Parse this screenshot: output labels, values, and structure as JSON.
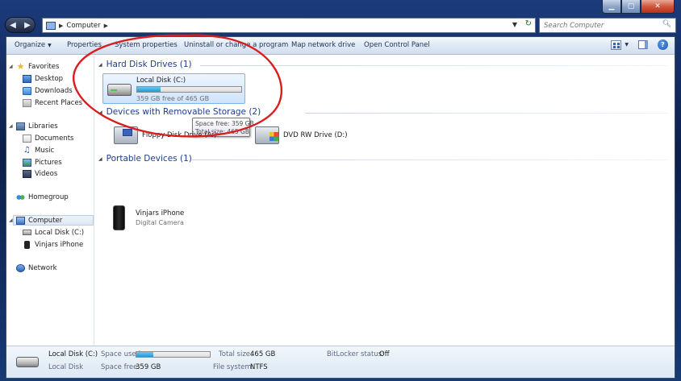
{
  "address": {
    "path": "Computer"
  },
  "search": {
    "placeholder": "Search Computer"
  },
  "toolbar": {
    "organize": "Organize",
    "properties": "Properties",
    "system_properties": "System properties",
    "uninstall": "Uninstall or change a program",
    "map_drive": "Map network drive",
    "control_panel": "Open Control Panel"
  },
  "nav": {
    "favorites": "Favorites",
    "desktop": "Desktop",
    "downloads": "Downloads",
    "recent_places": "Recent Places",
    "libraries": "Libraries",
    "documents": "Documents",
    "music": "Music",
    "pictures": "Pictures",
    "videos": "Videos",
    "homegroup": "Homegroup",
    "computer": "Computer",
    "local_disk": "Local Disk (C:)",
    "iphone": "Vinjars iPhone",
    "network": "Network"
  },
  "groups": {
    "hdd": "Hard Disk Drives (1)",
    "removable": "Devices with Removable Storage (2)",
    "portable": "Portable Devices (1)"
  },
  "drive_c": {
    "name": "Local Disk (C:)",
    "free_text": "359 GB free of 465 GB",
    "used_fraction": 0.228
  },
  "tooltip": {
    "free": "Space free: 359 GB",
    "total": "Total size: 465 GB"
  },
  "removable": {
    "floppy": "Floppy Disk Drive (A:)",
    "dvd": "DVD RW Drive (D:)"
  },
  "portable": {
    "name": "Vinjars iPhone",
    "type": "Digital Camera"
  },
  "details": {
    "name": "Local Disk (C:)",
    "type": "Local Disk",
    "space_used_label": "Space used:",
    "space_free_label": "Space free:",
    "space_free_value": "359 GB",
    "total_size_label": "Total size:",
    "total_size_value": "465 GB",
    "file_system_label": "File system:",
    "file_system_value": "NTFS",
    "bitlocker_label": "BitLocker status:",
    "bitlocker_value": "Off",
    "used_fraction": 0.228
  },
  "colors": {
    "annotation": "#d81e1e",
    "group_header": "#1e3c8c",
    "progress": "#1e9ad6"
  }
}
